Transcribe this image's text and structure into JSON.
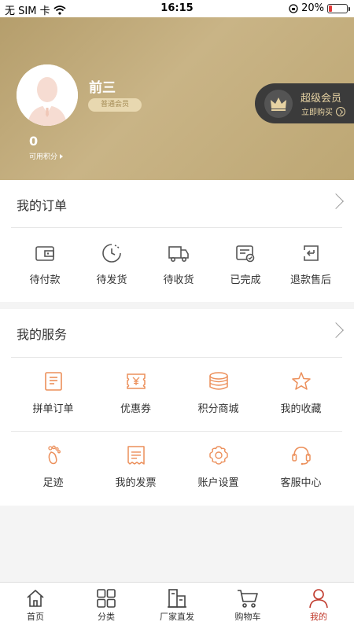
{
  "status_bar": {
    "carrier": "无 SIM 卡",
    "time": "16:15",
    "battery": "20%",
    "battery_level": 0.2
  },
  "profile": {
    "name": "前三",
    "level": "普通会员",
    "points": "0",
    "points_label": "可用积分"
  },
  "vip": {
    "title": "超级会员",
    "action": "立即购买"
  },
  "colors": {
    "header_gold": "#bda774",
    "vip_dark": "#3b3b3b",
    "vip_text": "#e7d3a3",
    "icon_gray": "#555555",
    "icon_orange": "#ec8f5a",
    "active_red": "#c0392b"
  },
  "orders": {
    "title": "我的订单",
    "items": [
      {
        "label": "待付款",
        "icon": "wallet-icon"
      },
      {
        "label": "待发货",
        "icon": "clock-icon"
      },
      {
        "label": "待收货",
        "icon": "truck-icon"
      },
      {
        "label": "已完成",
        "icon": "completed-card-icon"
      },
      {
        "label": "退款售后",
        "icon": "refund-icon"
      }
    ]
  },
  "services": {
    "title": "我的服务",
    "items": [
      {
        "label": "拼单订单",
        "icon": "clipboard-icon"
      },
      {
        "label": "优惠券",
        "icon": "coupon-icon"
      },
      {
        "label": "积分商城",
        "icon": "coins-icon"
      },
      {
        "label": "我的收藏",
        "icon": "star-icon"
      },
      {
        "label": "足迹",
        "icon": "footprint-icon"
      },
      {
        "label": "我的发票",
        "icon": "invoice-icon"
      },
      {
        "label": "账户设置",
        "icon": "settings-icon"
      },
      {
        "label": "客服中心",
        "icon": "headset-icon"
      }
    ]
  },
  "tabbar": {
    "items": [
      {
        "label": "首页",
        "icon": "home-icon"
      },
      {
        "label": "分类",
        "icon": "grid-icon"
      },
      {
        "label": "厂家直发",
        "icon": "factory-icon"
      },
      {
        "label": "购物车",
        "icon": "cart-icon"
      },
      {
        "label": "我的",
        "icon": "user-icon",
        "active": true
      }
    ]
  }
}
